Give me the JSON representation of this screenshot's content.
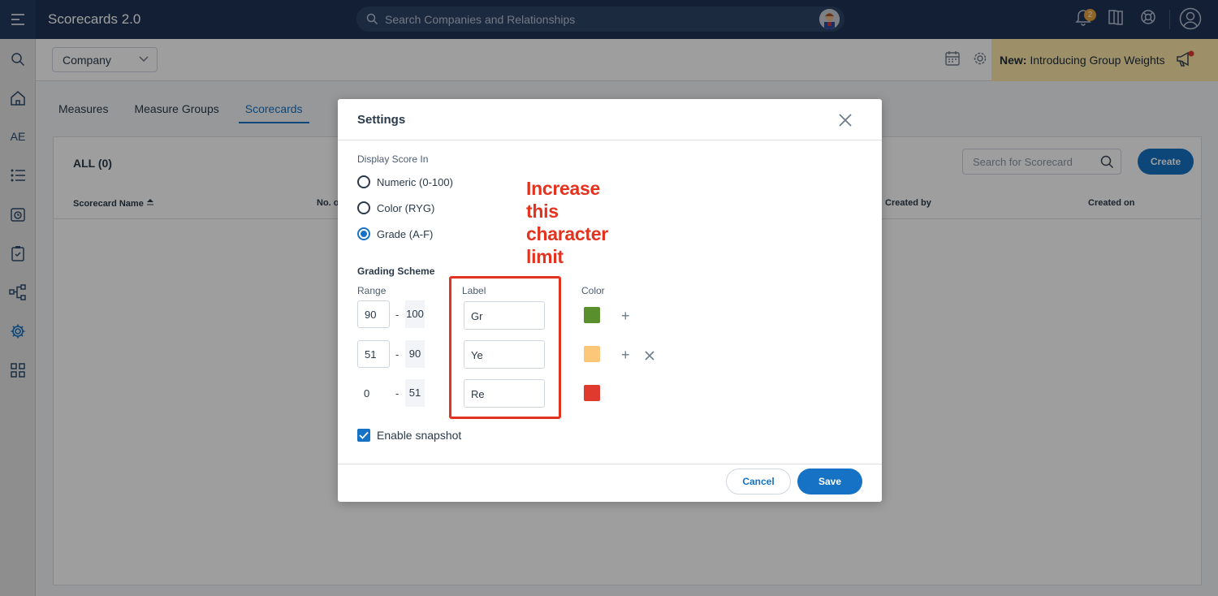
{
  "app": {
    "title": "Scorecards 2.0"
  },
  "global_search": {
    "placeholder": "Search Companies and Relationships"
  },
  "notifications": {
    "count": "2"
  },
  "sidebar": {
    "ae_label": "AE"
  },
  "subbar": {
    "company_select": "Company",
    "news_prefix": "New:",
    "news_text": "Introducing Group Weights"
  },
  "tabs": [
    {
      "label": "Measures"
    },
    {
      "label": "Measure Groups"
    },
    {
      "label": "Scorecards"
    }
  ],
  "list": {
    "all_count": "ALL (0)",
    "search_placeholder": "Search for Scorecard",
    "create_label": "Create",
    "columns": [
      "Scorecard Name",
      "No. o",
      "Created by",
      "Created on"
    ]
  },
  "modal": {
    "title": "Settings",
    "display_score_label": "Display Score In",
    "options": [
      {
        "label": "Numeric (0-100)",
        "checked": false
      },
      {
        "label": "Color (RYG)",
        "checked": false
      },
      {
        "label": "Grade (A-F)",
        "checked": true
      }
    ],
    "grading_scheme_title": "Grading Scheme",
    "range_header": "Range",
    "label_header": "Label",
    "color_header": "Color",
    "rows": [
      {
        "from": "90",
        "to": "100",
        "label": "Gr",
        "color": "#5a8f2e"
      },
      {
        "from": "51",
        "to": "90",
        "label": "Ye",
        "color": "#fdc77a"
      },
      {
        "from": "0",
        "to": "51",
        "label": "Re",
        "color": "#e03a2f"
      }
    ],
    "range_separator": "-",
    "enable_snapshot_label": "Enable snapshot",
    "enable_snapshot_checked": true,
    "cancel_label": "Cancel",
    "save_label": "Save"
  },
  "annotation": {
    "lines": [
      "Increase",
      "this",
      "character",
      "limit"
    ],
    "color": "#e3331f"
  }
}
